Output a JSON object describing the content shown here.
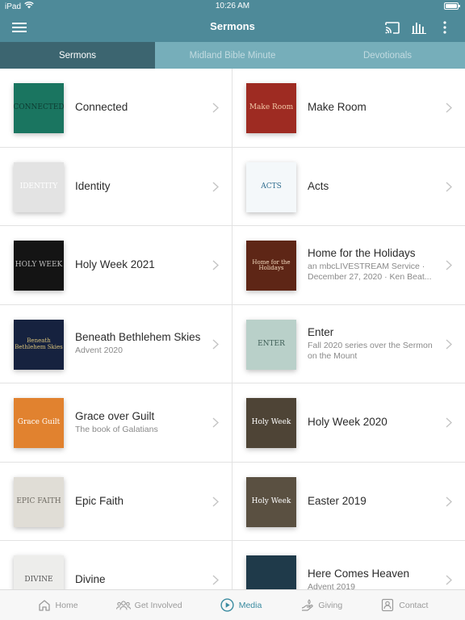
{
  "status_bar": {
    "carrier": "iPad",
    "time": "10:26 AM",
    "battery_level": 1.0
  },
  "header": {
    "title": "Sermons",
    "icons": [
      "menu-icon",
      "cast-icon",
      "audio-bars-icon",
      "more-vertical-icon"
    ]
  },
  "tabs": [
    {
      "label": "Sermons",
      "active": true
    },
    {
      "label": "Midland Bible Minute",
      "active": false
    },
    {
      "label": "Devotionals",
      "active": false
    }
  ],
  "series": [
    {
      "name": "connected",
      "title": "Connected",
      "subtitle": "",
      "thumb": {
        "text": "CONNECTED",
        "bg": "#1a7560",
        "fg": "#0d3b31"
      }
    },
    {
      "name": "make-room",
      "title": "Make Room",
      "subtitle": "",
      "thumb": {
        "text": "Make Room",
        "bg": "#9e2b22",
        "fg": "#f3c9a8"
      }
    },
    {
      "name": "identity",
      "title": "Identity",
      "subtitle": "",
      "thumb": {
        "text": "IDENTITY",
        "bg": "#e3e3e3",
        "fg": "#ffffff"
      }
    },
    {
      "name": "acts",
      "title": "Acts",
      "subtitle": "",
      "thumb": {
        "text": "ACTS",
        "bg": "#f4f8fa",
        "fg": "#2f6d8e"
      }
    },
    {
      "name": "holy-week-2021",
      "title": "Holy Week 2021",
      "subtitle": "",
      "thumb": {
        "text": "HOLY WEEK",
        "bg": "#141414",
        "fg": "#bdbdbd"
      }
    },
    {
      "name": "home-for-the-holidays",
      "title": "Home for the Holidays",
      "subtitle": "an mbcLIVESTREAM Service · December 27, 2020 · Ken Beat...",
      "thumb": {
        "text": "Home for the Holidays",
        "bg": "#5e2616",
        "fg": "#f5dcc0"
      }
    },
    {
      "name": "beneath-bethlehem-skies",
      "title": "Beneath Bethlehem Skies",
      "subtitle": "Advent 2020",
      "thumb": {
        "text": "Beneath Bethlehem Skies",
        "bg": "#16223f",
        "fg": "#d9c27a"
      }
    },
    {
      "name": "enter",
      "title": "Enter",
      "subtitle": "Fall 2020 series over the Sermon on the Mount",
      "thumb": {
        "text": "ENTER",
        "bg": "#b9d0c9",
        "fg": "#3e5e56"
      }
    },
    {
      "name": "grace-over-guilt",
      "title": "Grace over Guilt",
      "subtitle": "The book of Galatians",
      "thumb": {
        "text": "Grace Guilt",
        "bg": "#e1822f",
        "fg": "#ffffff"
      }
    },
    {
      "name": "holy-week-2020",
      "title": "Holy Week 2020",
      "subtitle": "",
      "thumb": {
        "text": "Holy Week",
        "bg": "#4e4436",
        "fg": "#ffffff"
      }
    },
    {
      "name": "epic-faith",
      "title": "Epic Faith",
      "subtitle": "",
      "thumb": {
        "text": "EPIC FAITH",
        "bg": "#e0ddd6",
        "fg": "#6e6a62"
      }
    },
    {
      "name": "easter-2019",
      "title": "Easter 2019",
      "subtitle": "",
      "thumb": {
        "text": "Holy Week",
        "bg": "#5a5041",
        "fg": "#ffffff"
      }
    },
    {
      "name": "divine",
      "title": "Divine",
      "subtitle": "",
      "thumb": {
        "text": "DIVINE",
        "bg": "#ededeb",
        "fg": "#555555"
      }
    },
    {
      "name": "here-comes-heaven",
      "title": "Here Comes Heaven",
      "subtitle": "Advent 2019",
      "thumb": {
        "text": "",
        "bg": "#1f3a4a",
        "fg": "#c9d6dc"
      }
    }
  ],
  "bottom_nav": [
    {
      "name": "home",
      "label": "Home",
      "icon": "home-icon",
      "active": false
    },
    {
      "name": "get-involved",
      "label": "Get Involved",
      "icon": "people-icon",
      "active": false
    },
    {
      "name": "media",
      "label": "Media",
      "icon": "play-circle-icon",
      "active": true
    },
    {
      "name": "giving",
      "label": "Giving",
      "icon": "giving-icon",
      "active": false
    },
    {
      "name": "contact",
      "label": "Contact",
      "icon": "contact-icon",
      "active": false
    }
  ],
  "colors": {
    "header": "#4e8a99",
    "tab_bar": "#76aeba",
    "tab_active": "#3c6570",
    "accent": "#3a8ba0"
  }
}
